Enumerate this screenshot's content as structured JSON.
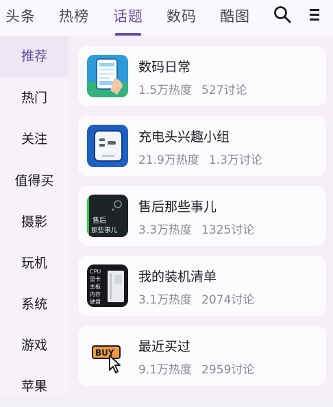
{
  "tabs": [
    "头条",
    "热榜",
    "话题",
    "数码",
    "酷图"
  ],
  "active_tab_index": 2,
  "toolbar": {
    "search_icon": "search-icon",
    "more_icon": "more-vertical-icon"
  },
  "sidebar": {
    "active_index": 0,
    "items": [
      "推荐",
      "热门",
      "关注",
      "值得买",
      "摄影",
      "玩机",
      "系统",
      "游戏",
      "苹果"
    ]
  },
  "topics": [
    {
      "title": "数码日常",
      "heat": "1.5万热度",
      "discuss": "527讨论",
      "icon": "phone-illustration-icon"
    },
    {
      "title": "充电头兴趣小组",
      "heat": "21.9万热度",
      "discuss": "1.3万讨论",
      "icon": "charger-icon"
    },
    {
      "title": "售后那些事儿",
      "heat": "3.3万热度",
      "discuss": "1325讨论",
      "icon": "after-sales-icon",
      "icon_text": "售后\n那些事儿"
    },
    {
      "title": "我的装机清单",
      "heat": "3.1万热度",
      "discuss": "2074讨论",
      "icon": "pc-build-icon",
      "icon_text": "CPU\n显卡\n主板\n内存\n硬盘"
    },
    {
      "title": "最近买过",
      "heat": "9.1万热度",
      "discuss": "2959讨论",
      "icon": "buy-cursor-icon",
      "icon_text": "BUY"
    }
  ],
  "colors": {
    "accent": "#6750a4",
    "text": "#1d1b20",
    "muted": "#8c8794"
  }
}
